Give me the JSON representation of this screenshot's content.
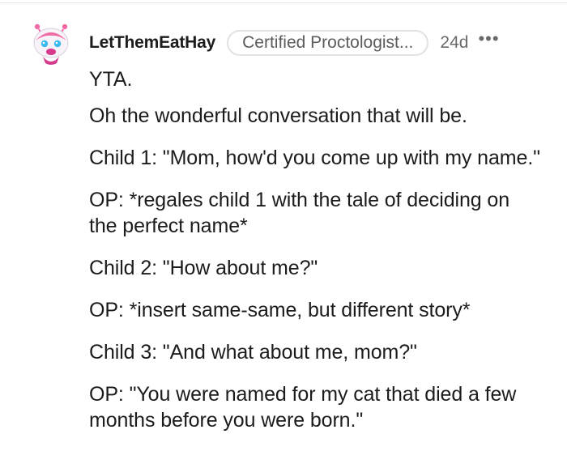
{
  "comment": {
    "author": "LetThemEatHay",
    "flair": "Certified Proctologist...",
    "age": "24d",
    "more_label": "•••",
    "paragraphs": [
      "YTA.",
      "Oh the wonderful conversation that will be.",
      "Child 1: \"Mom, how'd you come up with my name.\"",
      "OP: *regales child 1 with the tale of deciding on the perfect name*",
      "Child 2: \"How about me?\"",
      "OP: *insert same-same, but different story*",
      "Child 3: \"And what about me, mom?\"",
      "OP: \"You were named for my cat that died a few months before you were born.\""
    ]
  },
  "colors": {
    "avatar_pink": "#f06aa6",
    "avatar_magenta": "#d63a8c",
    "avatar_blue": "#38b9ef",
    "text": "#1c1c1c",
    "muted": "#6a6a6a"
  }
}
